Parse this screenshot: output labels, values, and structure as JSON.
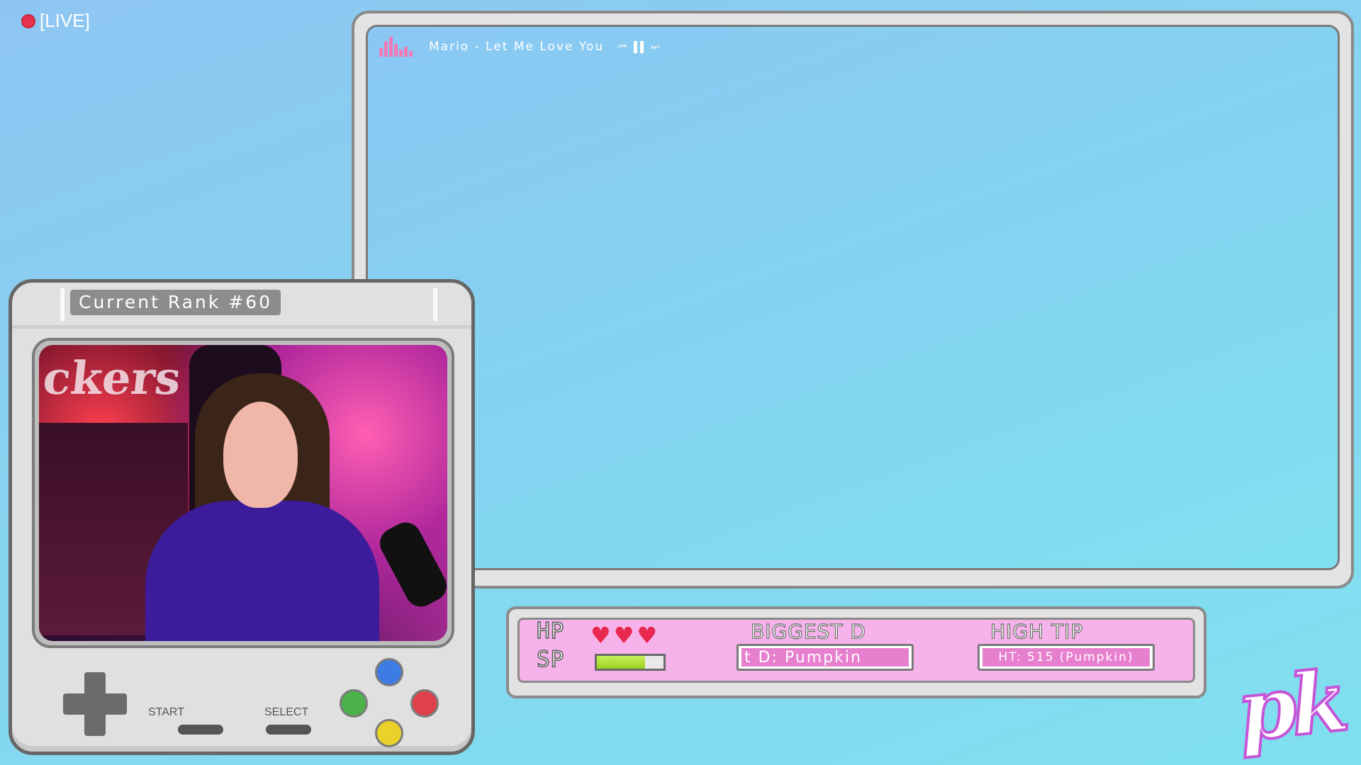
{
  "live": {
    "label": "[LIVE]"
  },
  "now_playing": {
    "track": "Mario - Let Me Love You",
    "prev_glyph": "⏮",
    "next_glyph": "⏭"
  },
  "console": {
    "rank_label": "Current Rank #60",
    "start_label": "START",
    "select_label": "SELECT",
    "buttons": {
      "x_color": "#3d7de3",
      "y_color": "#4bb34a",
      "a_color": "#e0404a",
      "b_color": "#ecd12a"
    }
  },
  "stats": {
    "hp_label": "HP",
    "sp_label": "SP",
    "hearts": [
      "♥",
      "♥",
      "♥"
    ],
    "sp_level": 0.72,
    "biggest_title": "BIGGEST D",
    "biggest_value": "t D: Pumpkin",
    "tip_title": "HIGH TIP",
    "tip_value": "HT: 515 (Pumpkin)"
  },
  "logo": {
    "text": "pk"
  },
  "colors": {
    "accent_pink": "#f6b2ea",
    "live_red": "#e8334f",
    "heart_red": "#e8284f",
    "sp_green": "#9ad11c"
  }
}
